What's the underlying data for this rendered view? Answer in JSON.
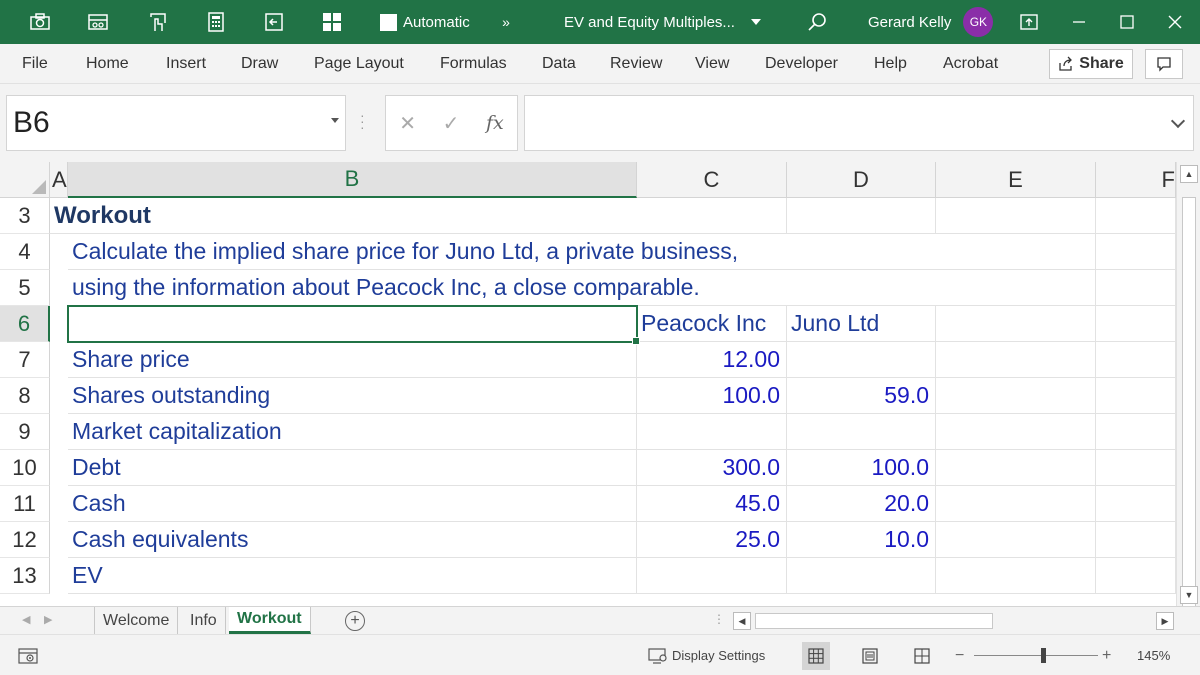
{
  "titlebar": {
    "autosave_label": "Automatic",
    "overflow_label": "»",
    "doc_title": "EV and Equity Multiples...",
    "user_name": "Gerard Kelly",
    "user_initials": "GK"
  },
  "ribbon": {
    "tabs": [
      "File",
      "Home",
      "Insert",
      "Draw",
      "Page Layout",
      "Formulas",
      "Data",
      "Review",
      "View",
      "Developer",
      "Help",
      "Acrobat"
    ],
    "share_label": "Share"
  },
  "formula_bar": {
    "name_box": "B6",
    "formula": ""
  },
  "grid": {
    "columns": [
      "A",
      "B",
      "C",
      "D",
      "E",
      "F"
    ],
    "active_column": "B",
    "rows": [
      "3",
      "4",
      "5",
      "6",
      "7",
      "8",
      "9",
      "10",
      "11",
      "12",
      "13"
    ],
    "active_row": "6",
    "title": "Workout",
    "instruction_line1": "Calculate the implied share price for Juno Ltd, a private business,",
    "instruction_line2": "using the information about Peacock Inc, a close comparable.",
    "header_c": "Peacock Inc",
    "header_d": "Juno Ltd",
    "labels": [
      "Share price",
      "Shares outstanding",
      "Market capitalization",
      "Debt",
      "Cash",
      "Cash equivalents",
      "EV"
    ],
    "peacock": [
      "12.00",
      "100.0",
      "",
      "300.0",
      "45.0",
      "25.0",
      ""
    ],
    "juno": [
      "",
      "59.0",
      "",
      "100.0",
      "20.0",
      "10.0",
      ""
    ]
  },
  "sheets": {
    "tabs": [
      "Welcome",
      "Info",
      "Workout"
    ],
    "active": "Workout"
  },
  "statusbar": {
    "display_settings": "Display Settings",
    "zoom": "145%"
  },
  "colors": {
    "accent": "#217346",
    "title_text": "#1f3864",
    "cell_text": "#1f3d99",
    "number_text": "#1a1ac2",
    "avatar": "#8a2ea8"
  }
}
